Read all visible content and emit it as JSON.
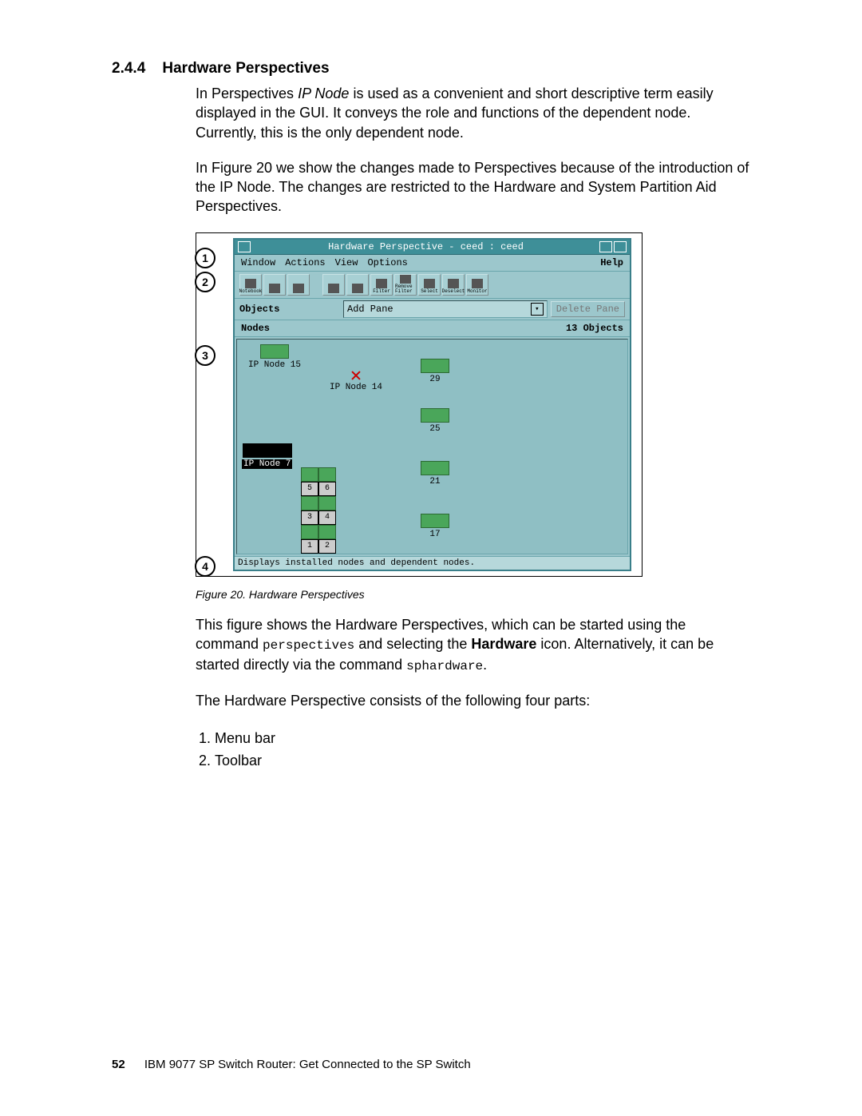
{
  "section": {
    "number": "2.4.4",
    "title": "Hardware Perspectives"
  },
  "paragraphs": {
    "p1a": "In Perspectives ",
    "p1_italic": "IP Node",
    "p1b": " is used as a convenient and short descriptive term easily displayed in the GUI. It conveys the role and functions of the dependent node. Currently, this is the only dependent node.",
    "p2": "In Figure 20 we show the changes made to Perspectives because of the introduction of the IP Node. The changes are restricted to the Hardware and System Partition Aid Perspectives.",
    "p3a": "This figure shows the Hardware Perspectives, which can be started using the command ",
    "p3_mono1": "perspectives",
    "p3b": " and selecting the ",
    "p3_bold": "Hardware",
    "p3c": " icon. Alternatively, it can be started directly via the command ",
    "p3_mono2": "sphardware",
    "p3d": ".",
    "p4": "The Hardware Perspective consists of the following four parts:"
  },
  "parts_list": {
    "i1": "Menu bar",
    "i2": "Toolbar"
  },
  "callouts": {
    "c1": "1",
    "c2": "2",
    "c3": "3",
    "c4": "4"
  },
  "figure": {
    "title": "Hardware Perspective - ceed : ceed",
    "menubar": {
      "m1": "Window",
      "m2": "Actions",
      "m3": "View",
      "m4": "Options",
      "help": "Help"
    },
    "toolbar_labels": {
      "t1": "Notebook",
      "t2": "",
      "t3": "",
      "t4": "",
      "t5": "",
      "t6": "Filter",
      "t7": "Remove Filter",
      "t8": "Select",
      "t9": "Deselect",
      "t10": "Monitor"
    },
    "panebar": {
      "objects": "Objects",
      "addpane": "Add Pane",
      "delete": "Delete Pane"
    },
    "pane_header": {
      "left": "Nodes",
      "right": "13 Objects"
    },
    "nodes": {
      "n15": "IP Node 15",
      "n14": "IP Node 14",
      "n7": "IP Node 7",
      "n29": "29",
      "n25": "25",
      "n21": "21",
      "n17": "17"
    },
    "slots": {
      "s5": "5",
      "s6": "6",
      "s3": "3",
      "s4": "4",
      "s1": "1",
      "s2": "2"
    },
    "status": "Displays installed nodes and dependent nodes.",
    "caption": "Figure 20.  Hardware Perspectives"
  },
  "footer": {
    "page": "52",
    "text": "IBM 9077 SP Switch Router: Get Connected to the SP Switch"
  }
}
